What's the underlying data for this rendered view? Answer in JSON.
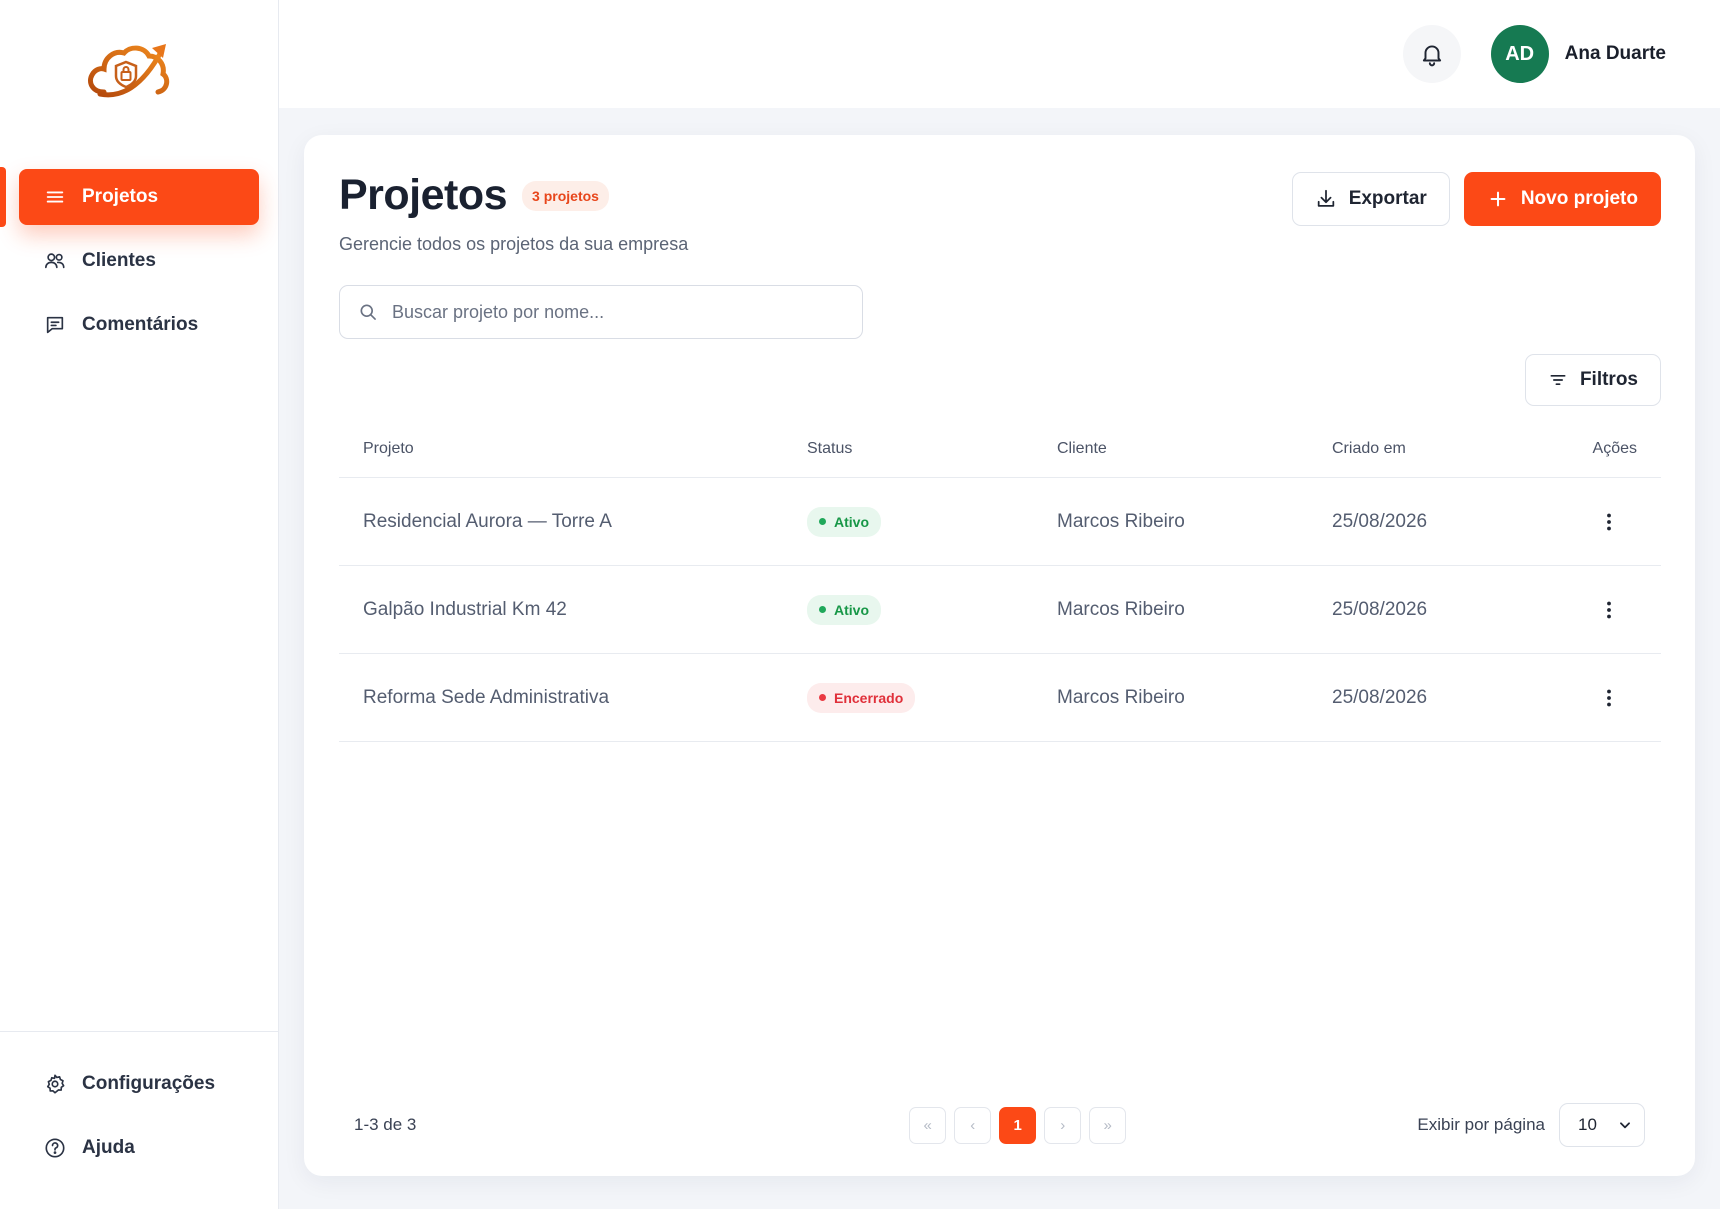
{
  "sidebar": {
    "nav": [
      {
        "label": "Projetos",
        "icon": "menu-icon",
        "active": true
      },
      {
        "label": "Clientes",
        "icon": "users-icon",
        "active": false
      },
      {
        "label": "Comentários",
        "icon": "message-icon",
        "active": false
      }
    ],
    "bottom": [
      {
        "label": "Configurações",
        "icon": "gear-icon"
      },
      {
        "label": "Ajuda",
        "icon": "help-circle-icon"
      }
    ]
  },
  "topbar": {
    "user_initials": "AD",
    "user_name": "Ana Duarte"
  },
  "page": {
    "title": "Projetos",
    "count_badge": "3 projetos",
    "subtitle": "Gerencie todos os projetos da sua empresa",
    "export_label": "Exportar",
    "new_label": "Novo projeto",
    "search_placeholder": "Buscar projeto por nome...",
    "filters_label": "Filtros"
  },
  "table": {
    "columns": [
      "Projeto",
      "Status",
      "Cliente",
      "Criado em",
      "Ações"
    ],
    "rows": [
      {
        "project": "Residencial Aurora — Torre A",
        "status": "Ativo",
        "client": "Marcos Ribeiro",
        "created": "25/08/2026"
      },
      {
        "project": "Galpão Industrial Km 42",
        "status": "Ativo",
        "client": "Marcos Ribeiro",
        "created": "25/08/2026"
      },
      {
        "project": "Reforma Sede Administrativa",
        "status": "Encerrado",
        "client": "Marcos Ribeiro",
        "created": "25/08/2026"
      }
    ]
  },
  "footer": {
    "range": "1-3 de 3",
    "pages": {
      "first": "«",
      "prev": "‹",
      "current": "1",
      "next": "›",
      "last": "»"
    },
    "per_page_label": "Exibir por página",
    "per_page_value": "10"
  },
  "colors": {
    "accent": "#fc4916",
    "avatar": "#167a52",
    "active_status": "#179747",
    "closed_status": "#e0303a"
  }
}
